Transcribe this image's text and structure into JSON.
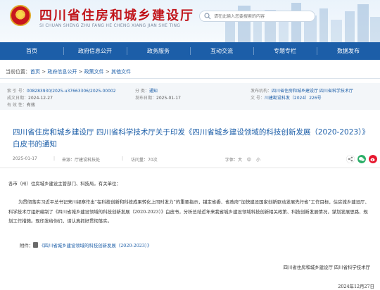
{
  "header": {
    "title": "四川省住房和城乡建设厅",
    "subtitle": "SI CHUAN SHENG ZHU FANG HE CHENG XIANG JIAN SHE TING",
    "search_placeholder": "请在此输入您要搜索的内容"
  },
  "nav": {
    "items": [
      {
        "label": "首页"
      },
      {
        "label": "政府信息公开"
      },
      {
        "label": "政务服务"
      },
      {
        "label": "互动交流"
      },
      {
        "label": "专题专栏"
      },
      {
        "label": "数据发布"
      }
    ]
  },
  "breadcrumb": {
    "prefix": "当前位置：",
    "items": [
      "首页",
      "政府信息公开",
      "政策文件",
      "其他文件"
    ],
    "separator": " > "
  },
  "meta": {
    "index_label": "索  引  号：",
    "index_value": "008283930/2025-u37663306/2025-00002",
    "category_label": "分        类：",
    "category_value": "通知",
    "issuer_label": "发布机构：",
    "issuer_value": "四川省住房和城乡建设厅  四川省科学技术厅",
    "written_label": "成文日期：",
    "written_value": "2024-12-27",
    "publish_label": "发布日期：",
    "publish_value": "2025-01-17",
    "docno_label": "文        号：",
    "docno_value": "川建勘设科发〔2024〕226号",
    "validity_label": "有  效  性：",
    "validity_value": "有效"
  },
  "article": {
    "title": "四川省住房和城乡建设厅 四川省科学技术厅关于印发《四川省城乡建设领域的科技创新发展（2020-2023）》白皮书的通知",
    "date": "2025-01-17",
    "source": "来源：厅建设科技处",
    "views": "访问量：70次",
    "font_label": "字体：",
    "font_large": "大",
    "font_mid": "中",
    "font_small": "小",
    "salutation": "各市（州）住房城乡建设主管部门、科技局，有关单位：",
    "paragraph1": "为贯彻落实习近平总书记来川视察作出“在科技创新和科技成果转化上同时发力”的重要指示，锚定省委、省政府“加快建设国家创新驱动发展先行省”工作目标，住房城乡建设厅、科学技术厅组织编制了《四川省城乡建设领域的科技创新发展（2020-2023）》白皮书，分析总结近年来我省城乡建设领域科技创新相关政策、科技创新发展情况，谋划发展思路、规划工作措施。现印发给你们，请认真抓好贯彻落实。",
    "attachment_label": "附件：",
    "attachment_link": "《四川省城乡建设领域的科技创新发展（2020-2023）》",
    "signature": "四川省住房和城乡建设厅    四川省科学技术厅",
    "sign_date": "2024年12月27日"
  },
  "colors": {
    "brand_red": "#c1161c",
    "nav_blue": "#1c5ea8"
  }
}
